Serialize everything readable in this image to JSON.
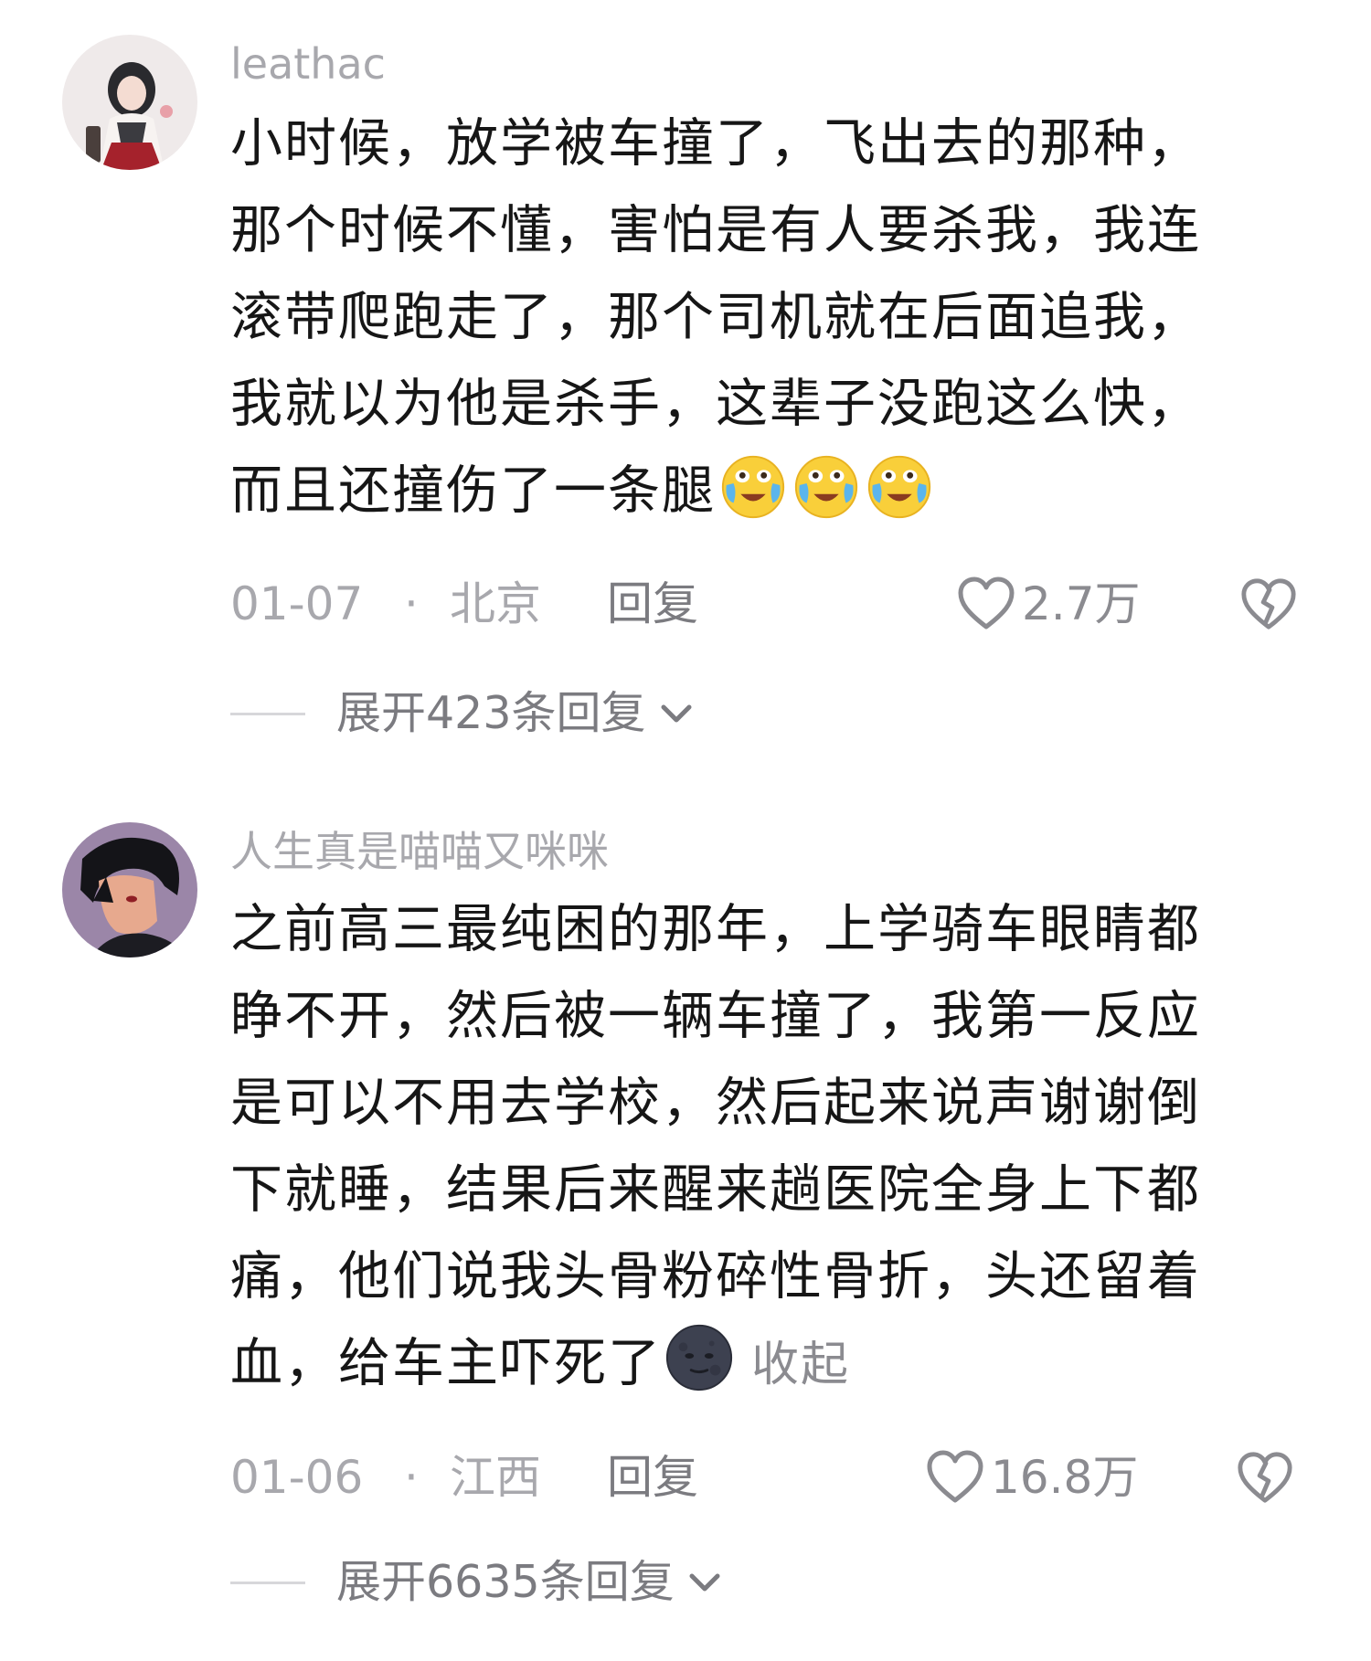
{
  "comments": [
    {
      "username": "leathac",
      "body_lines": [
        "小时候，放学被车撞了，飞出去的那种，",
        "那个时候不懂，害怕是有人要杀我，我连",
        "滚带爬跑走了，那个司机就在后面追我，",
        "我就以为他是杀手，这辈子没跑这么快，",
        "而且还撞伤了一条腿"
      ],
      "trailing_emoji": [
        "crying-laughing-emoji",
        "crying-laughing-emoji",
        "crying-laughing-emoji"
      ],
      "date": "01-07",
      "separator": "·",
      "location": "北京",
      "reply_label": "回复",
      "likes": "2.7万",
      "expand_label": "展开423条回复"
    },
    {
      "username": "人生真是喵喵又咪咪",
      "body_lines": [
        "之前高三最纯困的那年，上学骑车眼睛都",
        "睁不开，然后被一辆车撞了，我第一反应",
        "是可以不用去学校，然后起来说声谢谢倒",
        "下就睡，结果后来醒来趟医院全身上下都",
        "痛，他们说我头骨粉碎性骨折，头还留着",
        "血，给车主吓死了"
      ],
      "trailing_emoji": [
        "moon-face-emoji"
      ],
      "collapse_label": "收起",
      "date": "01-06",
      "separator": "·",
      "location": "江西",
      "reply_label": "回复",
      "likes": "16.8万",
      "expand_label": "展开6635条回复"
    }
  ],
  "icons": {
    "like": "heart-outline-icon",
    "dislike": "broken-heart-icon",
    "expand": "chevron-down-icon"
  },
  "colors": {
    "text": "#161616",
    "muted": "#a8a8ad",
    "secondary": "#7b7b80",
    "background": "#ffffff"
  }
}
